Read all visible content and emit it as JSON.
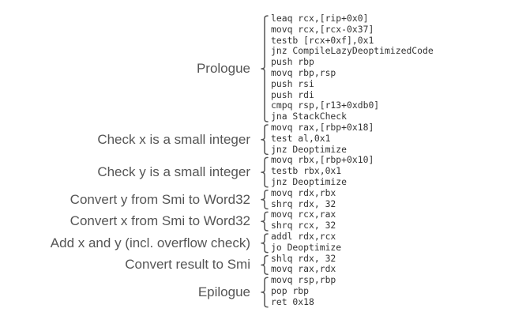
{
  "sections": [
    {
      "label": "Prologue",
      "lines": [
        "leaq rcx,[rip+0x0]",
        "movq rcx,[rcx-0x37]",
        "testb [rcx+0xf],0x1",
        "jnz CompileLazyDeoptimizedCode",
        "push rbp",
        "movq rbp,rsp",
        "push rsi",
        "push rdi",
        "cmpq rsp,[r13+0xdb0]",
        "jna StackCheck"
      ]
    },
    {
      "label": "Check x is a small integer",
      "lines": [
        "movq rax,[rbp+0x18]",
        "test al,0x1",
        "jnz Deoptimize"
      ]
    },
    {
      "label": "Check y is a small integer",
      "lines": [
        "movq rbx,[rbp+0x10]",
        "testb rbx,0x1",
        "jnz Deoptimize"
      ]
    },
    {
      "label": "Convert y from Smi to Word32",
      "lines": [
        "movq rdx,rbx",
        "shrq rdx, 32"
      ]
    },
    {
      "label": "Convert x from Smi to Word32",
      "lines": [
        "movq rcx,rax",
        "shrq rcx, 32"
      ]
    },
    {
      "label": "Add x and y (incl. overflow check)",
      "lines": [
        "addl rdx,rcx",
        "jo Deoptimize"
      ]
    },
    {
      "label": "Convert result to Smi",
      "lines": [
        "shlq rdx, 32",
        "movq rax,rdx"
      ]
    },
    {
      "label": "Epilogue",
      "lines": [
        "movq rsp,rbp",
        "pop rbp",
        "ret 0x18"
      ]
    }
  ]
}
